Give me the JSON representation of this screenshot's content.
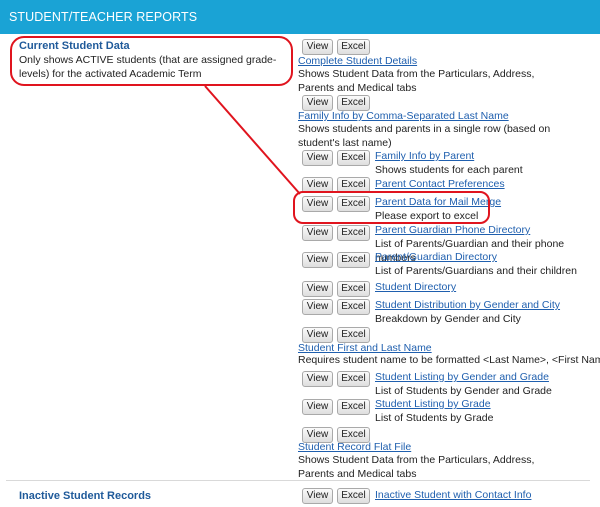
{
  "header": {
    "title": "STUDENT/TEACHER REPORTS"
  },
  "section1": {
    "title": "Current Student Data",
    "description": "Only shows ACTIVE students (that are assigned grade-levels) for the activated Academic Term"
  },
  "section2": {
    "title": "Inactive Student Records"
  },
  "buttons": {
    "view": "View",
    "excel": "Excel"
  },
  "reports": [
    {
      "name": "Complete Student Details",
      "desc": "Shows Student Data from the Particulars, Address, Parents and Medical tabs"
    },
    {
      "name": "Family Info by Comma-Separated Last Name",
      "desc": "Shows students and parents in a single row (based on student's last name)"
    },
    {
      "name": "Family Info by Parent",
      "desc": "Shows students for each parent"
    },
    {
      "name": "Parent Contact Preferences",
      "desc": ""
    },
    {
      "name": "Parent Data for Mail Merge",
      "desc": "Please export to excel"
    },
    {
      "name": "Parent Guardian Phone Directory",
      "desc": "List of Parents/Guardian and their phone numbers"
    },
    {
      "name": "Parent/Guardian Directory",
      "desc": "List of Parents/Guardians and their children"
    },
    {
      "name": "Student Directory",
      "desc": ""
    },
    {
      "name": "Student Distribution by Gender and City",
      "desc": "Breakdown by Gender and City"
    },
    {
      "name": "Student First and Last Name",
      "desc": "Requires student name to be formatted <Last Name>, <First Name>"
    },
    {
      "name": "Student Listing by Gender and Grade",
      "desc": "List of Students by Gender and Grade"
    },
    {
      "name": "Student Listing by Grade",
      "desc": "List of Students by Grade"
    },
    {
      "name": "Student Record Flat File",
      "desc": "Shows Student Data from the Particulars, Address, Parents and Medical tabs"
    },
    {
      "name": "Inactive Student with Contact Info",
      "desc": ""
    }
  ],
  "annotation_color": "#e0141e"
}
